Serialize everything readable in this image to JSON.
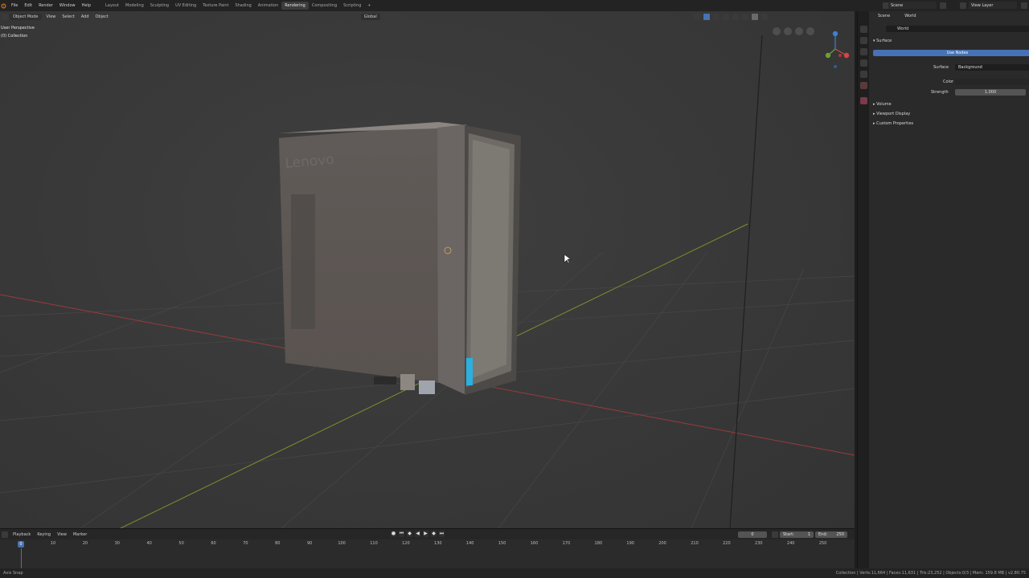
{
  "topbar": {
    "menus": [
      "File",
      "Edit",
      "Render",
      "Window",
      "Help"
    ],
    "workspaces": [
      "Layout",
      "Modeling",
      "Sculpting",
      "UV Editing",
      "Texture Paint",
      "Shading",
      "Animation",
      "Rendering",
      "Compositing",
      "Scripting"
    ],
    "active_workspace": "Rendering",
    "add_tab": "+",
    "scene": "Scene",
    "view_layer": "View Layer"
  },
  "viewport": {
    "mode": "Object Mode",
    "menus": [
      "View",
      "Select",
      "Add",
      "Object"
    ],
    "orientation": "Global",
    "perspective": "User Perspective",
    "collection": "(0) Collection"
  },
  "properties": {
    "breadcrumb_scene": "Scene",
    "breadcrumb_world": "World",
    "world_name": "World",
    "surface_panel": "Surface",
    "use_nodes": "Use Nodes",
    "surface_label": "Surface",
    "surface_value": "Background",
    "color_label": "Color",
    "strength_label": "Strength",
    "strength_value": "1.000",
    "collapsed_panels": [
      "Volume",
      "Viewport Display",
      "Custom Properties"
    ]
  },
  "timeline": {
    "menus": [
      "Playback",
      "Keying",
      "View",
      "Marker"
    ],
    "current_frame": "0",
    "start_label": "Start:",
    "start_value": "1",
    "end_label": "End:",
    "end_value": "250",
    "current_frame_field": "0",
    "ruler_ticks": [
      "10",
      "20",
      "30",
      "40",
      "50",
      "60",
      "70",
      "80",
      "90",
      "100",
      "110",
      "120",
      "130",
      "140",
      "150",
      "160",
      "170",
      "180",
      "190",
      "200",
      "210",
      "220",
      "230",
      "240",
      "250"
    ]
  },
  "statusbar": {
    "left": "Axis Snap",
    "right": "Collection | Verts:11,664 | Faces:11,631 | Tris:23,252 | Objects:0/3 | Mem: 159.8 MB | v2.80.75"
  },
  "colors": {
    "accent": "#4772b3",
    "viewport_bg": "#3a3a3a",
    "x_axis": "#9a3b3b",
    "y_axis": "#7e8f2e"
  }
}
